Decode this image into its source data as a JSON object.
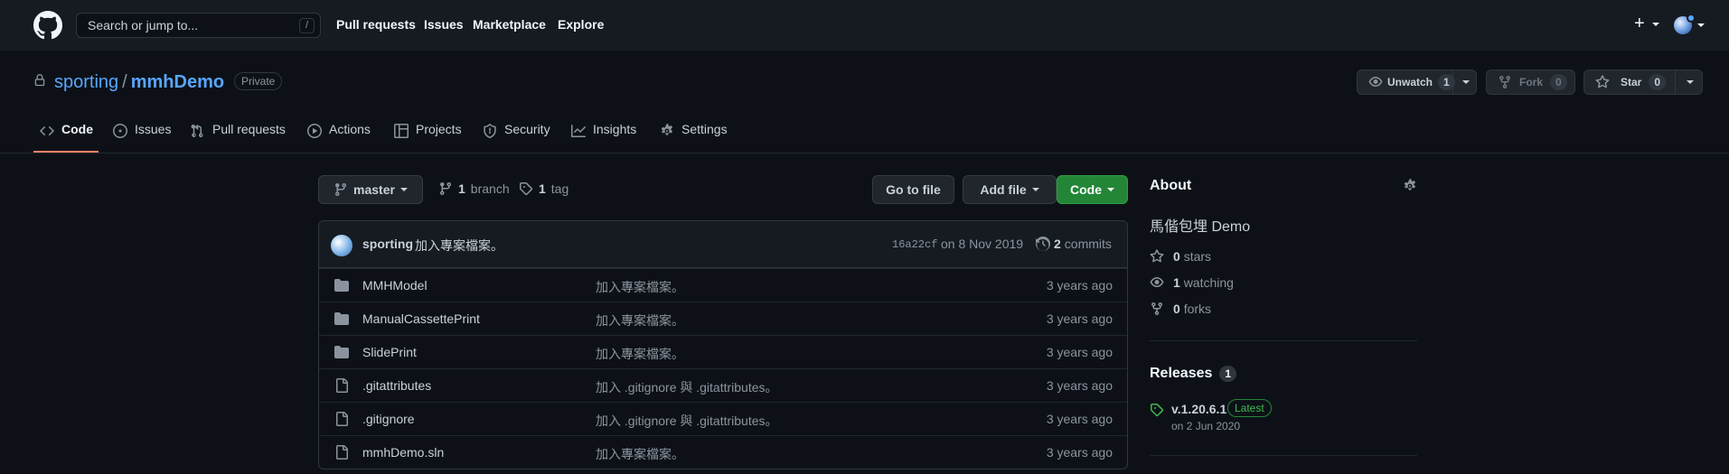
{
  "colors": {
    "background": "#0d1117",
    "header": "#161b22",
    "link": "#58a6ff",
    "accent_green": "#238636",
    "tab_underline": "#f78166"
  },
  "header": {
    "search_placeholder": "Search or jump to...",
    "search_shortcut": "/",
    "nav": [
      "Pull requests",
      "Issues",
      "Marketplace",
      "Explore"
    ],
    "plus": "+"
  },
  "repo": {
    "owner": "sporting",
    "separator": "/",
    "name": "mmhDemo",
    "visibility": "Private",
    "unwatch_label": "Unwatch",
    "watch_count": "1",
    "fork_label": "Fork",
    "fork_count": "0",
    "star_label": "Star",
    "star_count": "0"
  },
  "tabs": [
    {
      "label": "Code",
      "icon": "code-icon",
      "selected": true
    },
    {
      "label": "Issues",
      "icon": "issue-icon"
    },
    {
      "label": "Pull requests",
      "icon": "pull-request-icon"
    },
    {
      "label": "Actions",
      "icon": "play-icon"
    },
    {
      "label": "Projects",
      "icon": "table-icon"
    },
    {
      "label": "Security",
      "icon": "shield-icon"
    },
    {
      "label": "Insights",
      "icon": "graph-icon"
    },
    {
      "label": "Settings",
      "icon": "gear-icon"
    }
  ],
  "toolbar": {
    "branch": "master",
    "branch_count": "1",
    "branch_label": "branch",
    "tag_count": "1",
    "tag_label": "tag",
    "go_to_file": "Go to file",
    "add_file": "Add file",
    "code": "Code"
  },
  "commit": {
    "author": "sporting",
    "message": "加入專案檔案。",
    "sha": "16a22cf",
    "date": "on 8 Nov 2019",
    "count": "2",
    "count_label": "commits"
  },
  "files": [
    {
      "type": "folder",
      "name": "MMHModel",
      "message": "加入專案檔案。",
      "age": "3 years ago"
    },
    {
      "type": "folder",
      "name": "ManualCassettePrint",
      "message": "加入專案檔案。",
      "age": "3 years ago"
    },
    {
      "type": "folder",
      "name": "SlidePrint",
      "message": "加入專案檔案。",
      "age": "3 years ago"
    },
    {
      "type": "file",
      "name": ".gitattributes",
      "message": "加入 .gitignore 與 .gitattributes。",
      "age": "3 years ago"
    },
    {
      "type": "file",
      "name": ".gitignore",
      "message": "加入 .gitignore 與 .gitattributes。",
      "age": "3 years ago"
    },
    {
      "type": "file",
      "name": "mmhDemo.sln",
      "message": "加入專案檔案。",
      "age": "3 years ago"
    }
  ],
  "about": {
    "title": "About",
    "description": "馬偕包埋 Demo",
    "stars_count": "0",
    "stars_label": "stars",
    "watching_count": "1",
    "watching_label": "watching",
    "forks_count": "0",
    "forks_label": "forks"
  },
  "releases": {
    "title": "Releases",
    "count": "1",
    "tag": "v.1.20.6.1",
    "latest": "Latest",
    "date": "on 2 Jun 2020"
  }
}
